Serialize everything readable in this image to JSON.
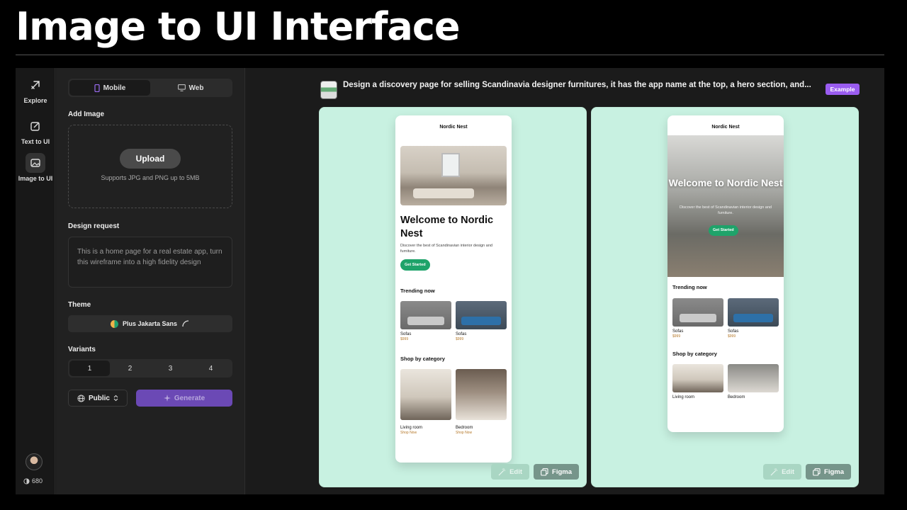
{
  "slide": {
    "title": "Image to UI Interface"
  },
  "nav": {
    "items": [
      {
        "label": "Explore",
        "icon": "explore-icon"
      },
      {
        "label": "Text to UI",
        "icon": "edit-icon"
      },
      {
        "label": "Image to UI",
        "icon": "image-icon"
      }
    ],
    "credits": "680"
  },
  "panel": {
    "platform": {
      "mobile": "Mobile",
      "web": "Web",
      "selected": "Mobile"
    },
    "add_image_label": "Add Image",
    "upload_button": "Upload",
    "upload_hint": "Supports JPG and PNG up to 5MB",
    "design_request_label": "Design request",
    "design_request_placeholder": "This is a home page for a real estate app, turn this wireframe into a high fidelity design",
    "theme_label": "Theme",
    "theme_value": "Plus Jakarta Sans",
    "variants_label": "Variants",
    "variants": [
      "1",
      "2",
      "3",
      "4"
    ],
    "variants_selected": "1",
    "visibility": "Public",
    "generate_button": "Generate"
  },
  "main": {
    "prompt": "Design a discovery page for selling Scandinavia designer furnitures, it has the app name at the top, a hero section, and...",
    "example_badge": "Example",
    "edit_label": "Edit",
    "figma_label": "Figma",
    "canvas_bg": "#c8f1e1"
  },
  "preview1": {
    "app_name": "Nordic Nest",
    "hero_title": "Welcome to Nordic Nest",
    "hero_sub": "Discover the best of Scandinavian interior design and furniture.",
    "cta": "Get Started",
    "trending": "Trending now",
    "trend_items": [
      {
        "name": "Sofas",
        "price": "$999"
      },
      {
        "name": "Sofas",
        "price": "$999"
      }
    ],
    "shop_by": "Shop by category",
    "categories": [
      {
        "name": "Living room",
        "link": "Shop Now"
      },
      {
        "name": "Bedroom",
        "link": "Shop Now"
      }
    ]
  },
  "preview2": {
    "app_name": "Nordic Nest",
    "hero_title": "Welcome to Nordic Nest",
    "hero_sub": "Discover the best of Scandinavian interior design and furniture.",
    "cta": "Get Started",
    "trending": "Trending now",
    "trend_items": [
      {
        "name": "Sofas",
        "price": "$999"
      },
      {
        "name": "Sofas",
        "price": "$999"
      }
    ],
    "shop_by": "Shop by category",
    "categories": [
      {
        "name": "Living room"
      },
      {
        "name": "Bedroom"
      }
    ]
  }
}
